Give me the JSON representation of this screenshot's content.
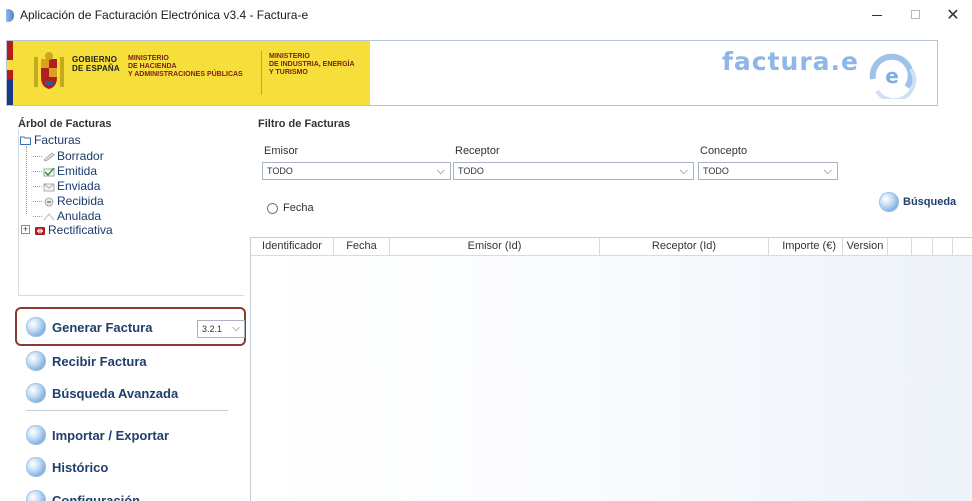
{
  "window": {
    "title": "Aplicación de Facturación Electrónica v3.4 - Factura-e",
    "minimize": "—",
    "close": "✕"
  },
  "banner": {
    "gobierno": [
      "GOBIERNO",
      "DE ESPAÑA"
    ],
    "ministerio1": [
      "MINISTERIO",
      "DE HACIENDA",
      "Y ADMINISTRACIONES PÚBLICAS"
    ],
    "ministerio2": [
      "MINISTERIO",
      "DE INDUSTRIA, ENERGÍA",
      "Y TURISMO"
    ],
    "logo": "factura.e"
  },
  "tree": {
    "title": "Árbol de Facturas",
    "root": "Facturas",
    "children": [
      "Borrador",
      "Emitida",
      "Enviada",
      "Recibida",
      "Anulada"
    ],
    "rectificativa": "Rectificativa",
    "expander": "+"
  },
  "actions": {
    "generar": "Generar Factura",
    "version": "3.2.1",
    "recibir": "Recibir Factura",
    "busqueda_avanzada": "Búsqueda Avanzada",
    "importar": "Importar / Exportar",
    "historico": "Histórico",
    "configuracion": "Configuración"
  },
  "filter": {
    "title": "Filtro de Facturas",
    "emisor_label": "Emisor",
    "emisor_value": "TODO",
    "receptor_label": "Receptor",
    "receptor_value": "TODO",
    "concepto_label": "Concepto",
    "concepto_value": "TODO",
    "fecha_label": "Fecha",
    "busqueda": "Búsqueda"
  },
  "table": {
    "columns": [
      "Identificador",
      "Fecha",
      "Emisor (Id)",
      "Receptor (Id)",
      "Importe (€)",
      "Version",
      "",
      "",
      ""
    ]
  },
  "colors": {
    "accent": "#1f3f6e",
    "highlight_border": "#8a3b34",
    "banner_yellow": "#f6df3a"
  }
}
